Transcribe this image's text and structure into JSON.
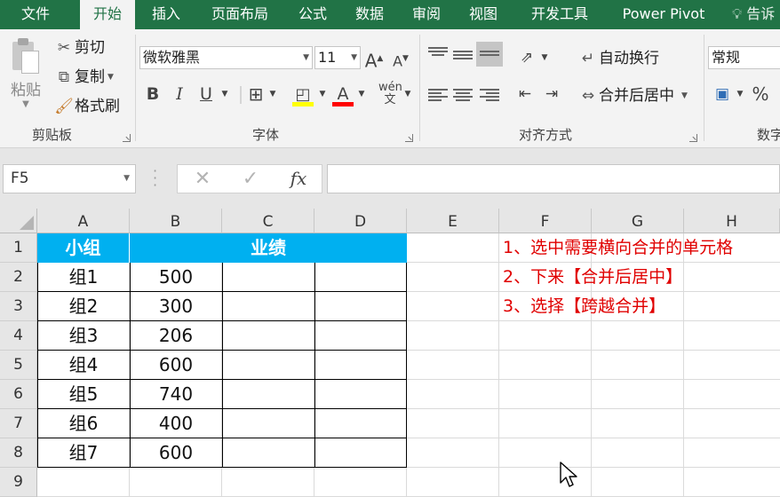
{
  "menu": {
    "tabs": [
      "文件",
      "开始",
      "插入",
      "页面布局",
      "公式",
      "数据",
      "审阅",
      "视图",
      "开发工具",
      "Power Pivot"
    ],
    "active_tab": "开始",
    "tell_me": "告诉"
  },
  "ribbon": {
    "clipboard": {
      "paste": "粘贴",
      "cut": "剪切",
      "copy": "复制",
      "format_painter": "格式刷",
      "label": "剪贴板"
    },
    "font": {
      "font_name": "微软雅黑",
      "font_size": "11",
      "label": "字体",
      "fill_color": "#ffff00",
      "font_color": "#ff0000"
    },
    "alignment": {
      "wrap_text": "自动换行",
      "merge_center": "合并后居中",
      "label": "对齐方式"
    },
    "number": {
      "format": "常规",
      "percent": "%",
      "label": "数字"
    }
  },
  "formula_bar": {
    "name_box": "F5",
    "formula": ""
  },
  "sheet": {
    "columns": [
      "A",
      "B",
      "C",
      "D",
      "E",
      "F",
      "G",
      "H"
    ],
    "rows": [
      "1",
      "2",
      "3",
      "4",
      "5",
      "6",
      "7",
      "8",
      "9"
    ],
    "header_row": {
      "group": "小组",
      "performance": "业绩"
    },
    "header_fill": "#00b0f0",
    "data": [
      {
        "group": "组1",
        "value": "500"
      },
      {
        "group": "组2",
        "value": "300"
      },
      {
        "group": "组3",
        "value": "206"
      },
      {
        "group": "组4",
        "value": "600"
      },
      {
        "group": "组5",
        "value": "740"
      },
      {
        "group": "组6",
        "value": "400"
      },
      {
        "group": "组7",
        "value": "600"
      }
    ],
    "notes": [
      "1、选中需要横向合并的单元格",
      "2、下来【合并后居中】",
      "3、选择【跨越合并】"
    ],
    "note_color": "#e00000"
  }
}
